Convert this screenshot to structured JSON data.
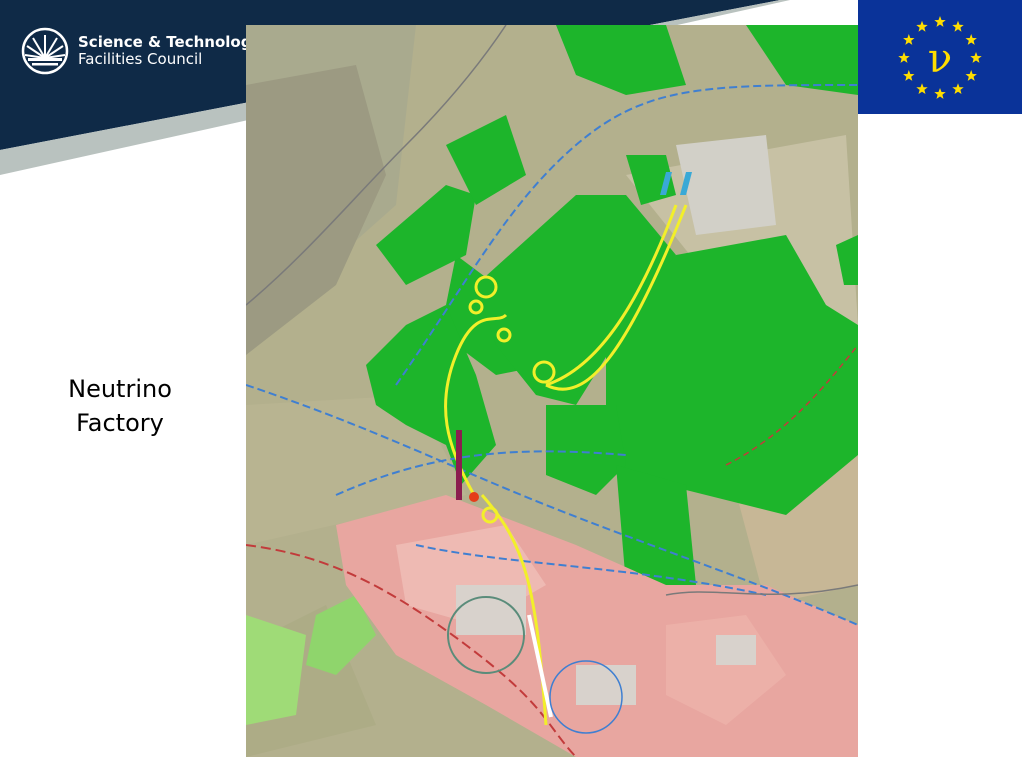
{
  "header": {
    "org_name_line1": "Science & Technology",
    "org_name_line2": "Facilities Council",
    "band_color": "#0f2a47",
    "stripe_color": "#b9c2bf",
    "eu_badge": {
      "background": "#0a3399",
      "star_color": "#ffde00",
      "symbol": "ν"
    }
  },
  "slide": {
    "title_line1": "Neutrino",
    "title_line2": "Factory"
  },
  "map": {
    "content": "aerial-site-plan",
    "colors": {
      "field": "#b3b08d",
      "forest": "#1db52b",
      "urban": "#e8a6a0",
      "facility_rings": "#f2ef2a",
      "roads": "#3f7fd1",
      "border": "#c23b3b"
    }
  }
}
